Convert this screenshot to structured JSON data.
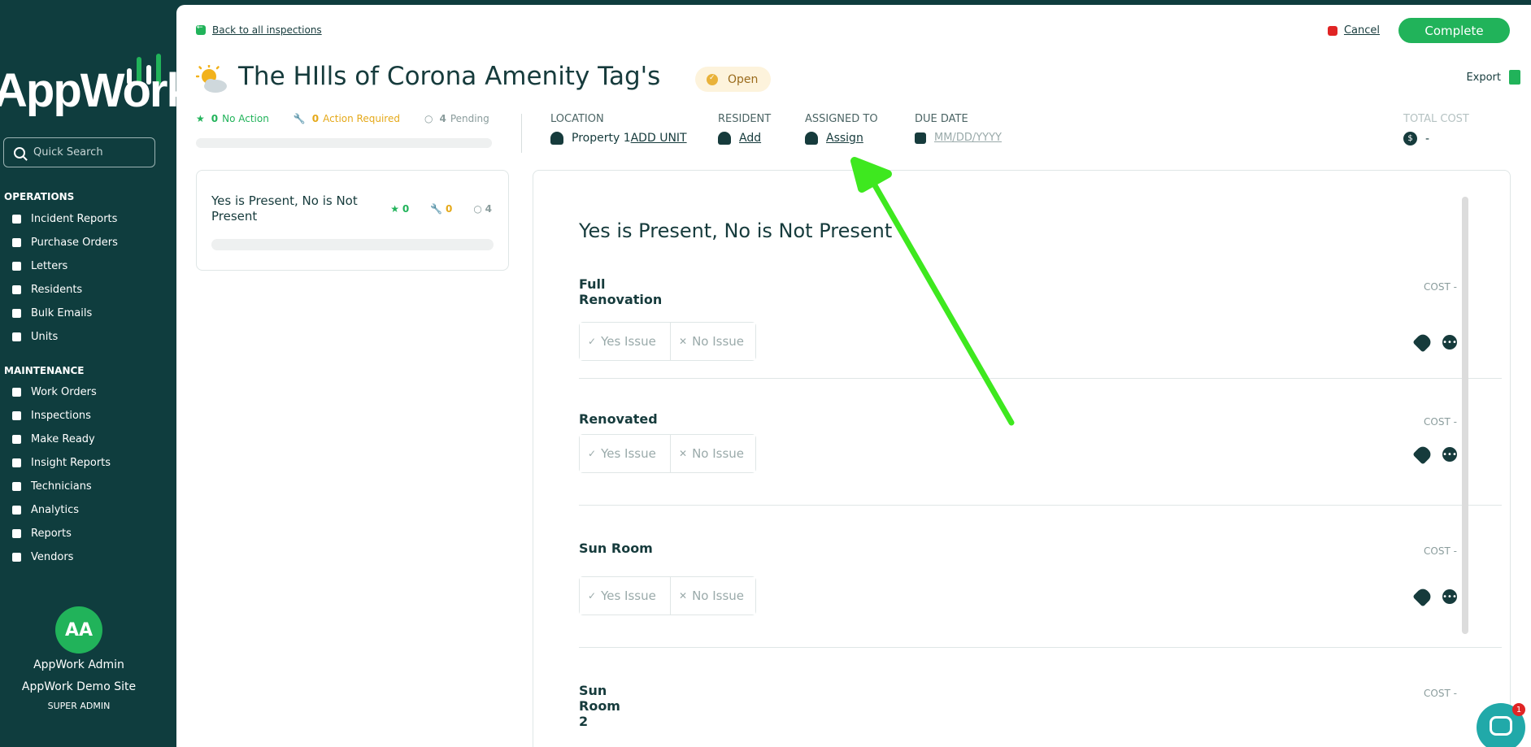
{
  "sidebar": {
    "logo_text": "AppWork",
    "search_placeholder": "Quick Search",
    "operations_title": "OPERATIONS",
    "operations_items": [
      "Incident Reports",
      "Purchase Orders",
      "Letters",
      "Residents",
      "Bulk Emails",
      "Units"
    ],
    "maintenance_title": "MAINTENANCE",
    "maintenance_items": [
      "Work Orders",
      "Inspections",
      "Make Ready",
      "Insight Reports",
      "Technicians",
      "Analytics",
      "Reports",
      "Vendors"
    ],
    "user": {
      "initials": "AA",
      "name": "AppWork Admin",
      "site": "AppWork Demo Site",
      "role": "SUPER ADMIN"
    }
  },
  "header": {
    "back_label": "Back to all inspections",
    "cancel_label": "Cancel",
    "complete_label": "Complete",
    "title": "The HIlls of Corona Amenity Tag's",
    "status": "Open",
    "export_label": "Export"
  },
  "stats": {
    "no_action_count": "0",
    "no_action_label": "No Action",
    "action_required_count": "0",
    "action_required_label": "Action Required",
    "pending_count": "4",
    "pending_label": "Pending"
  },
  "meta": {
    "location_label": "LOCATION",
    "location_value": "Property 1",
    "add_unit_label": "ADD UNIT",
    "resident_label": "RESIDENT",
    "resident_value": "Add",
    "assigned_label": "ASSIGNED TO",
    "assigned_value": "Assign",
    "due_label": "DUE DATE",
    "due_placeholder": "MM/DD/YYYY",
    "total_cost_label": "TOTAL COST",
    "total_cost_value": "-"
  },
  "section_card": {
    "name": "Yes is Present, No is Not Present",
    "green": "0",
    "yellow": "0",
    "pending": "4"
  },
  "panel": {
    "title": "Yes is Present, No is Not Present",
    "cost_label": "COST",
    "cost_value": "-",
    "yes_label": "Yes Issue",
    "no_label": "No Issue",
    "items": [
      "Full Renovation",
      "Renovated",
      "Sun Room",
      "Sun Room 2"
    ]
  },
  "chat": {
    "badge": "1"
  },
  "colors": {
    "brand_green": "#21b35a",
    "sidebar_bg": "#0f3d3e",
    "arrow": "#3ee81f"
  }
}
